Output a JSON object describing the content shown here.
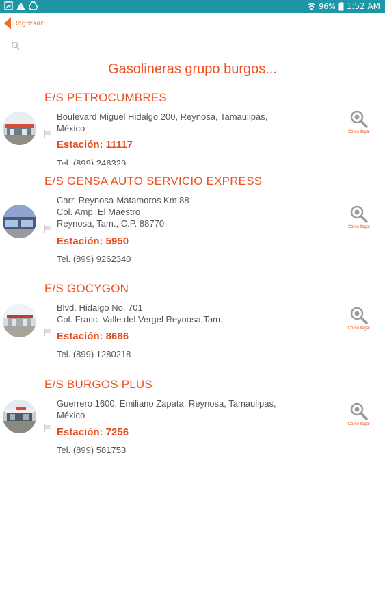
{
  "statusbar": {
    "battery": "96%",
    "time": "1:52 AM"
  },
  "nav": {
    "back_label": "Regresar"
  },
  "search": {
    "placeholder": "",
    "value": ""
  },
  "page_title": "Gasolineras grupo burgos...",
  "route_label": "Cómo llegar",
  "stations": [
    {
      "name": "E/S PETROCUMBRES",
      "address": [
        "Boulevard Miguel Hidalgo 200, Reynosa, Tamaulipas,",
        "México"
      ],
      "station": "Estación: 11117",
      "tel": "Tel. (899) 246329"
    },
    {
      "name": "E/S GENSA AUTO SERVICIO EXPRESS",
      "address": [
        "Carr. Reynosa-Matamoros Km 88",
        "Col. Amp. El Maestro",
        "Reynosa, Tam., C.P. 88770"
      ],
      "station": "Estación: 5950",
      "tel": "Tel. (899) 9262340"
    },
    {
      "name": "E/S GOCYGON",
      "address": [
        "Blvd. Hidalgo No. 701",
        "Col. Fracc. Valle del Vergel Reynosa,Tam."
      ],
      "station": "Estación: 8686",
      "tel": "Tel. (899) 1280218"
    },
    {
      "name": "E/S BURGOS PLUS",
      "address": [
        "Guerrero 1600, Emiliano Zapata, Reynosa, Tamaulipas,",
        "México"
      ],
      "station": "Estación: 7256",
      "tel": "Tel. (899) 581753"
    }
  ],
  "colors": {
    "accent": "#f0501f",
    "statusbar": "#1f96a6"
  }
}
